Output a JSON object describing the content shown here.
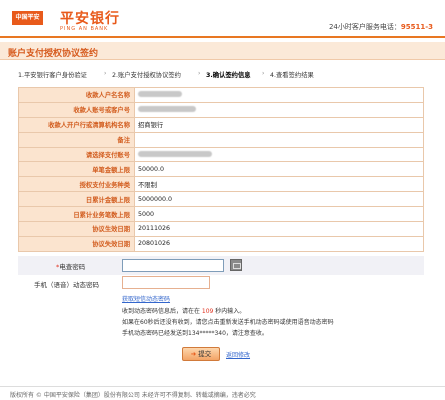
{
  "header": {
    "logo_badge": "中国平安",
    "logo_cn": "平安银行",
    "logo_en": "PING AN BANK",
    "hotline_label": "24小时客户服务电话：",
    "hotline_number": "95511-3",
    "accent_color": "#e85a1b"
  },
  "page_title": "账户支付授权协议签约",
  "steps": [
    {
      "label": "1.平安银行客户身份验证",
      "active": false
    },
    {
      "label": "2.账户支付授权协议签约",
      "active": false
    },
    {
      "label": "3.确认签约信息",
      "active": true
    },
    {
      "label": "4.查看签约结果",
      "active": false
    }
  ],
  "step_separator": "›",
  "info_rows": [
    {
      "label": "收款人户名名称",
      "value": "",
      "masked": true
    },
    {
      "label": "收款人账号或客户号",
      "value": "",
      "masked": true
    },
    {
      "label": "收款人开户行或清算机构名称",
      "value": "招商银行",
      "masked": false
    },
    {
      "label": "备注",
      "value": "",
      "masked": false
    },
    {
      "label": "请选择支付账号",
      "value": "",
      "masked": true
    },
    {
      "label": "单笔金额上限",
      "value": "50000.0",
      "masked": false
    },
    {
      "label": "授权支付业务种类",
      "value": "不限制",
      "masked": false
    },
    {
      "label": "日累计金额上限",
      "value": "5000000.0",
      "masked": false
    },
    {
      "label": "日累计业务笔数上限",
      "value": "5000",
      "masked": false
    },
    {
      "label": "协议生效日期",
      "value": "20111026",
      "masked": false
    },
    {
      "label": "协议失效日期",
      "value": "20801026",
      "masked": false
    }
  ],
  "form": {
    "password_star": "*",
    "password_label": "电查密码",
    "otp_label": "手机（语音）动态密码",
    "get_otp_link": "获取短信动态密码",
    "note1_pre": "收到动态密码信息后，请在在 ",
    "note1_seconds": "109",
    "note1_post": " 秒内输入。",
    "note2": "如果在60秒后还没有收到，请您点击重新发送手机动态密码或使用语音动态密码",
    "note3": "手机动态密码已经发送到134*****340，请注意查收。"
  },
  "buttons": {
    "prev_arrow": "➜",
    "prev_label": "提交",
    "cancel_label": "返回修改"
  },
  "footer": {
    "text": "版权所有 © 中国平安保险（集团）股份有限公司 未经许可不得复制、转载或摘编，违者必究"
  }
}
